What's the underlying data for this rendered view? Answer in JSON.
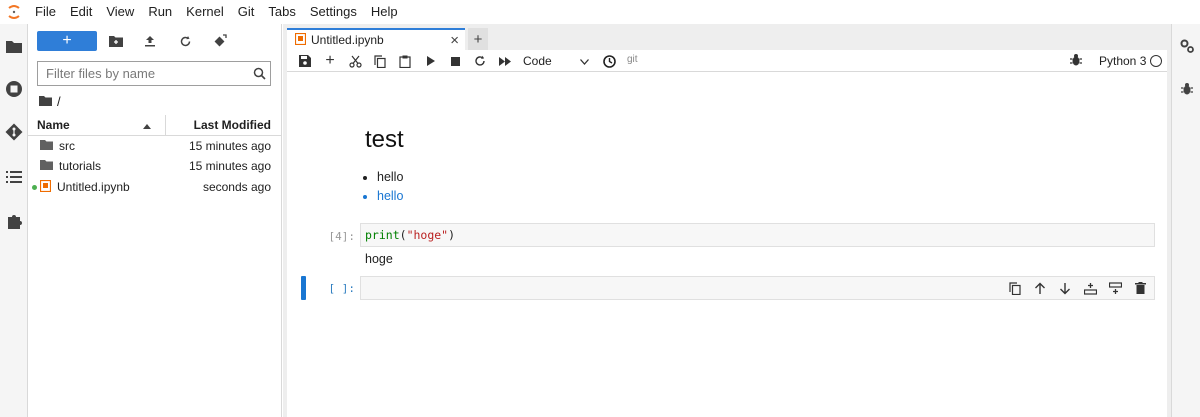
{
  "menu": [
    "File",
    "Edit",
    "View",
    "Run",
    "Kernel",
    "Git",
    "Tabs",
    "Settings",
    "Help"
  ],
  "left_rail": [
    "folder-icon",
    "running-icon",
    "git-icon",
    "toc-icon",
    "extension-icon"
  ],
  "file_browser": {
    "new_button_label": "+",
    "search_placeholder": "Filter files by name",
    "breadcrumb": "/",
    "columns": {
      "name": "Name",
      "modified": "Last Modified"
    },
    "rows": [
      {
        "name": "src",
        "modified": "15 minutes ago",
        "type": "folder"
      },
      {
        "name": "tutorials",
        "modified": "15 minutes ago",
        "type": "folder"
      },
      {
        "name": "Untitled.ipynb",
        "modified": "seconds ago",
        "type": "notebook",
        "running": true
      }
    ]
  },
  "tab": {
    "title": "Untitled.ipynb",
    "close": "×",
    "add": "+"
  },
  "toolbar": {
    "cell_type": "Code",
    "git_label": "git",
    "kernel": "Python 3"
  },
  "notebook": {
    "markdown": {
      "heading": "test",
      "bullets": [
        "hello",
        "hello"
      ]
    },
    "code_cell": {
      "prompt": "[4]:",
      "code_fn": "print",
      "code_open": "(",
      "code_str": "\"hoge\"",
      "code_close": ")",
      "output": "hoge"
    },
    "empty_cell": {
      "prompt": "[ ]:"
    }
  },
  "right_rail": [
    "property-inspector-icon",
    "debugger-icon"
  ],
  "colors": {
    "accent": "#2f7ed8",
    "link": "#1976d2",
    "running": "#4caf50"
  }
}
